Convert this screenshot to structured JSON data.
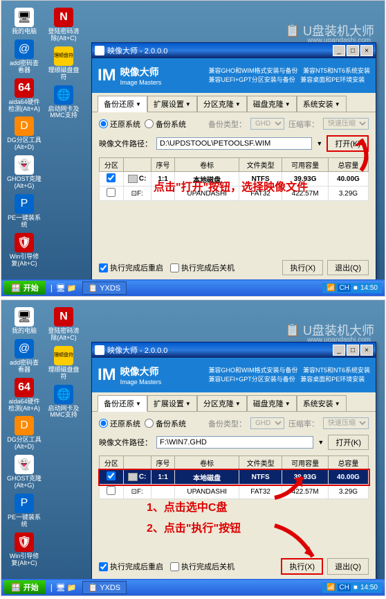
{
  "brand": "U盘装机大师",
  "brand_url": "www.upandashi.com",
  "desktop_icons_left": [
    {
      "label": "我的电脑",
      "cls": ""
    },
    {
      "label": "add密码查看器",
      "cls": "dicon-blue"
    },
    {
      "label": "aida64硬件检测(Alt+A)",
      "cls": "dicon-red",
      "glyph": "64"
    },
    {
      "label": "DG分区工具(Alt+D)",
      "cls": "dicon-orange"
    },
    {
      "label": "GHOST克隆(Alt+G)",
      "cls": ""
    },
    {
      "label": "PE一键装系统",
      "cls": "dicon-blue"
    },
    {
      "label": "Win引导修复(Alt+C)",
      "cls": "dicon-red"
    }
  ],
  "desktop_icons_right": [
    {
      "label": "登陆密码清除(Alt+C)",
      "cls": "dicon-red",
      "glyph": "N"
    },
    {
      "label": "理顺磁盘盘符",
      "cls": "dicon-yel",
      "glyph": "理顺盘符"
    },
    {
      "label": "启动网卡及MMC支持",
      "cls": "dicon-blue"
    }
  ],
  "window": {
    "title": "映像大师 - 2.0.0.0",
    "banner_logo": "IM",
    "banner_title": "映像大师",
    "banner_sub": "Image Masters",
    "features": [
      "兼容GHO和WIM格式安装与备份",
      "兼容NT5和NT6系统安装",
      "兼容UEFI+GPT分区安装与备份",
      "兼容桌面和PE环境安装"
    ]
  },
  "tabs": [
    "备份还原",
    "扩展设置",
    "分区克隆",
    "磁盘克隆",
    "系统安装"
  ],
  "radios": {
    "restore": "还原系统",
    "backup": "备份系统"
  },
  "labels": {
    "backup_type": "备份类型：",
    "compress": "压缩率：",
    "path": "映像文件路径：",
    "open": "打开(K)",
    "chk_restart": "执行完成后重启",
    "chk_shutdown": "执行完成后关机",
    "execute": "执行(X)",
    "exit": "退出(Q)"
  },
  "sel_ghd": "GHD",
  "sel_compress": "快速压缩",
  "path1": "D:\\UPDSTOOL\\PETOOLSF.WIM",
  "path2": "F:\\WIN7.GHD",
  "table_headers": [
    "分区",
    "",
    "序号",
    "卷标",
    "文件类型",
    "可用容量",
    "总容量"
  ],
  "rows": [
    {
      "chk": true,
      "drive": "C:",
      "num": "1:1",
      "label": "本地磁盘",
      "fs": "NTFS",
      "free": "39.93G",
      "total": "40.00G"
    },
    {
      "chk": false,
      "drive": "F:",
      "num": "",
      "label": "UPANDASHI",
      "fs": "FAT32",
      "free": "422.57M",
      "total": "3.29G"
    }
  ],
  "annot1": "点击\"打开\"按钮，选择映像文件",
  "annot2a": "1、点击选中C盘",
  "annot2b": "2、点击\"执行\"按钮",
  "taskbar": {
    "start": "开始",
    "task": "YXDS",
    "time": "14:50"
  }
}
